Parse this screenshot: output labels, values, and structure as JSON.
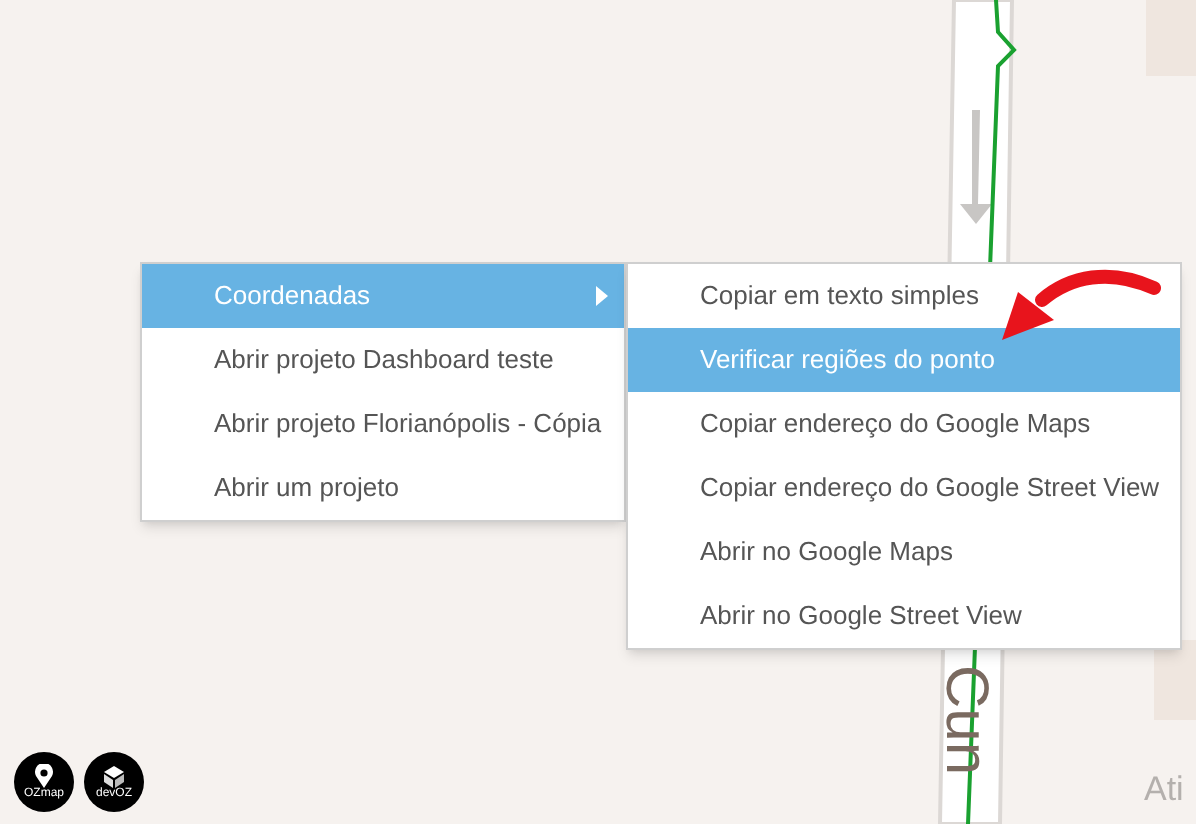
{
  "map": {
    "street_labels": [
      {
        "text": "Cun",
        "kind": "vertical"
      },
      {
        "text": "Ati",
        "kind": "horizontal"
      }
    ]
  },
  "context_menu": {
    "items": [
      {
        "label": "Coordenadas",
        "selected": true,
        "has_submenu": true
      },
      {
        "label": "Abrir projeto Dashboard teste",
        "selected": false,
        "has_submenu": false
      },
      {
        "label": "Abrir projeto Florianópolis - Cópia",
        "selected": false,
        "has_submenu": false
      },
      {
        "label": "Abrir um projeto",
        "selected": false,
        "has_submenu": false
      }
    ]
  },
  "submenu": {
    "items": [
      {
        "label": "Copiar em texto simples",
        "selected": false
      },
      {
        "label": "Verificar regiões do ponto",
        "selected": true
      },
      {
        "label": "Copiar endereço do Google Maps",
        "selected": false
      },
      {
        "label": "Copiar endereço do Google Street View",
        "selected": false
      },
      {
        "label": "Abrir no Google Maps",
        "selected": false
      },
      {
        "label": "Abrir no Google Street View",
        "selected": false
      }
    ]
  },
  "app_buttons": [
    {
      "label": "OZmap",
      "kind": "pin"
    },
    {
      "label": "devOZ",
      "kind": "box"
    }
  ]
}
